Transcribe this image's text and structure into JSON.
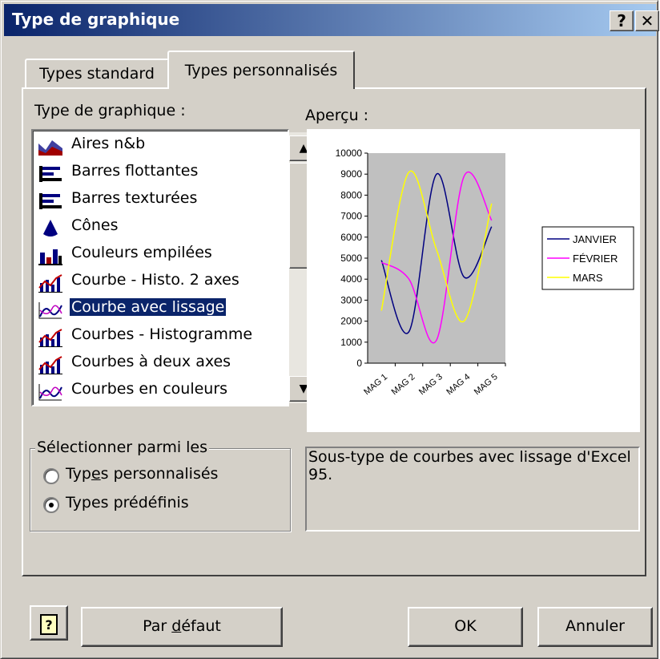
{
  "window": {
    "title": "Type de graphique",
    "help_glyph": "?",
    "close_glyph": "✕"
  },
  "tabs": [
    {
      "label": "Types standard",
      "active": false
    },
    {
      "label": "Types personnalisés",
      "active": true
    }
  ],
  "chart_type_label": "Type de graphique :",
  "chart_types": [
    {
      "label": "Aires n&b",
      "icon": "area-chart-icon",
      "selected": false
    },
    {
      "label": "Barres flottantes",
      "icon": "bar-chart-icon",
      "selected": false
    },
    {
      "label": "Barres texturées",
      "icon": "bar-chart-icon",
      "selected": false
    },
    {
      "label": "Cônes",
      "icon": "cone-icon",
      "selected": false
    },
    {
      "label": "Couleurs empilées",
      "icon": "column-chart-icon",
      "selected": false
    },
    {
      "label": "Courbe - Histo. 2 axes",
      "icon": "line-column-icon",
      "selected": false
    },
    {
      "label": "Courbe avec lissage",
      "icon": "smooth-line-icon",
      "selected": true
    },
    {
      "label": "Courbes - Histogramme",
      "icon": "line-column-icon",
      "selected": false
    },
    {
      "label": "Courbes à deux axes",
      "icon": "line-column-icon",
      "selected": false
    },
    {
      "label": "Courbes en couleurs",
      "icon": "smooth-line-icon",
      "selected": false
    }
  ],
  "preview_label": "Aperçu :",
  "selection_group": {
    "title": "Sélectionner parmi les",
    "options": [
      {
        "label_pre": "Typ",
        "label_u": "e",
        "label_post": "s personnalisés",
        "checked": false
      },
      {
        "label_pre": "Types prédéf",
        "label_u": "i",
        "label_post": "nis",
        "checked": true
      }
    ]
  },
  "description": "Sous-type de courbes avec lissage d'Excel 95.",
  "buttons": {
    "help_glyph": "?",
    "default_pre": "Par ",
    "default_u": "d",
    "default_post": "éfaut",
    "ok": "OK",
    "cancel": "Annuler"
  },
  "colors": {
    "plot_background": "#c0c0c0",
    "selection": "#0a246a"
  },
  "chart_data": {
    "type": "line",
    "smooth": true,
    "categories": [
      "MAG 1",
      "MAG 2",
      "MAG 3",
      "MAG 4",
      "MAG 5"
    ],
    "ylim": [
      0,
      10000
    ],
    "yticks": [
      "0",
      "1000",
      "2000",
      "3000",
      "4000",
      "5000",
      "6000",
      "7000",
      "8000",
      "9000",
      "10000"
    ],
    "legend_position": "right",
    "grid": false,
    "series": [
      {
        "name": "JANVIER",
        "color": "#000080",
        "values": [
          4900,
          1500,
          9000,
          4100,
          6500
        ]
      },
      {
        "name": "FÉVRIER",
        "color": "#ff00ff",
        "values": [
          4800,
          4000,
          1100,
          8900,
          6800
        ]
      },
      {
        "name": "MARS",
        "color": "#ffff00",
        "values": [
          2500,
          9100,
          5400,
          2000,
          7600
        ]
      }
    ]
  }
}
